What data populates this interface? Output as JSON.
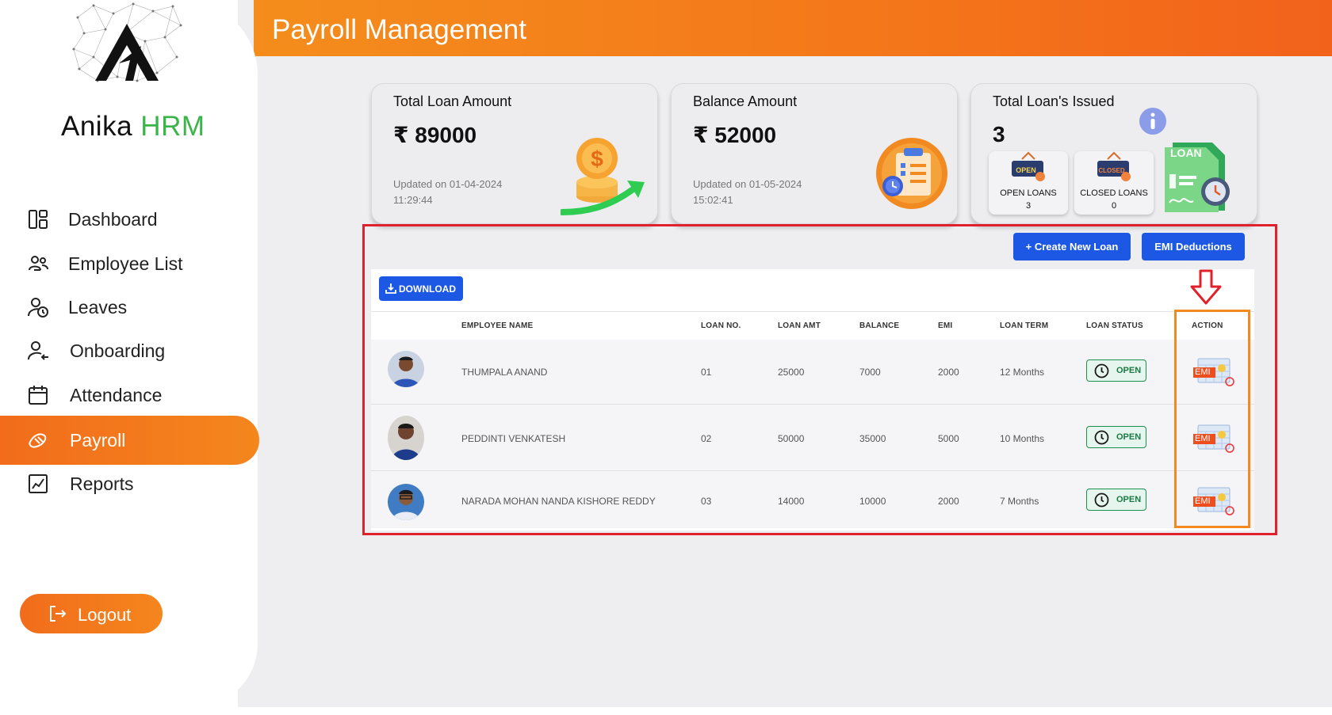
{
  "header": {
    "title": "Payroll Management"
  },
  "brand": {
    "name_part1": "Anika",
    "name_part2": "HRM"
  },
  "sidebar": {
    "items": [
      {
        "label": "Dashboard"
      },
      {
        "label": "Employee List"
      },
      {
        "label": "Leaves"
      },
      {
        "label": "Onboarding"
      },
      {
        "label": "Attendance"
      },
      {
        "label": "Payroll"
      },
      {
        "label": "Reports"
      }
    ],
    "active_item": "Payroll",
    "logout_label": "Logout"
  },
  "cards": {
    "total_loan": {
      "title": "Total Loan Amount",
      "value": "₹ 89000",
      "updated": "Updated on 01-04-2024 11:29:44"
    },
    "balance": {
      "title": "Balance Amount",
      "value": "₹ 52000",
      "updated": "Updated on 01-05-2024 15:02:41"
    },
    "issued": {
      "title": "Total Loan's Issued",
      "value": "3",
      "open": {
        "badge": "OPEN",
        "label": "OPEN LOANS",
        "count": "3"
      },
      "closed": {
        "badge": "CLOSED",
        "label": "CLOSED LOANS",
        "count": "0"
      },
      "loan_graphic_text": "LOAN"
    }
  },
  "actions": {
    "create_loan": "+ Create New Loan",
    "emi_deductions": "EMI Deductions",
    "download": "DOWNLOAD"
  },
  "table": {
    "columns": [
      "EMPLOYEE NAME",
      "LOAN NO.",
      "LOAN AMT",
      "BALANCE",
      "EMI",
      "LOAN TERM",
      "LOAN STATUS",
      "ACTION"
    ],
    "rows": [
      {
        "name": "THUMPALA ANAND",
        "loan_no": "01",
        "loan_amt": "25000",
        "balance": "7000",
        "emi": "2000",
        "term": "12 Months",
        "status": "OPEN"
      },
      {
        "name": "PEDDINTI VENKATESH",
        "loan_no": "02",
        "loan_amt": "50000",
        "balance": "35000",
        "emi": "5000",
        "term": "10 Months",
        "status": "OPEN"
      },
      {
        "name": "NARADA MOHAN NANDA KISHORE REDDY",
        "loan_no": "03",
        "loan_amt": "14000",
        "balance": "10000",
        "emi": "2000",
        "term": "7 Months",
        "status": "OPEN"
      }
    ],
    "action_icon_text": "EMI"
  },
  "colors": {
    "accent_orange": "#f4761a",
    "primary_blue": "#1c58e4",
    "status_green": "#1a8f4e",
    "highlight_red": "#e0202a"
  }
}
